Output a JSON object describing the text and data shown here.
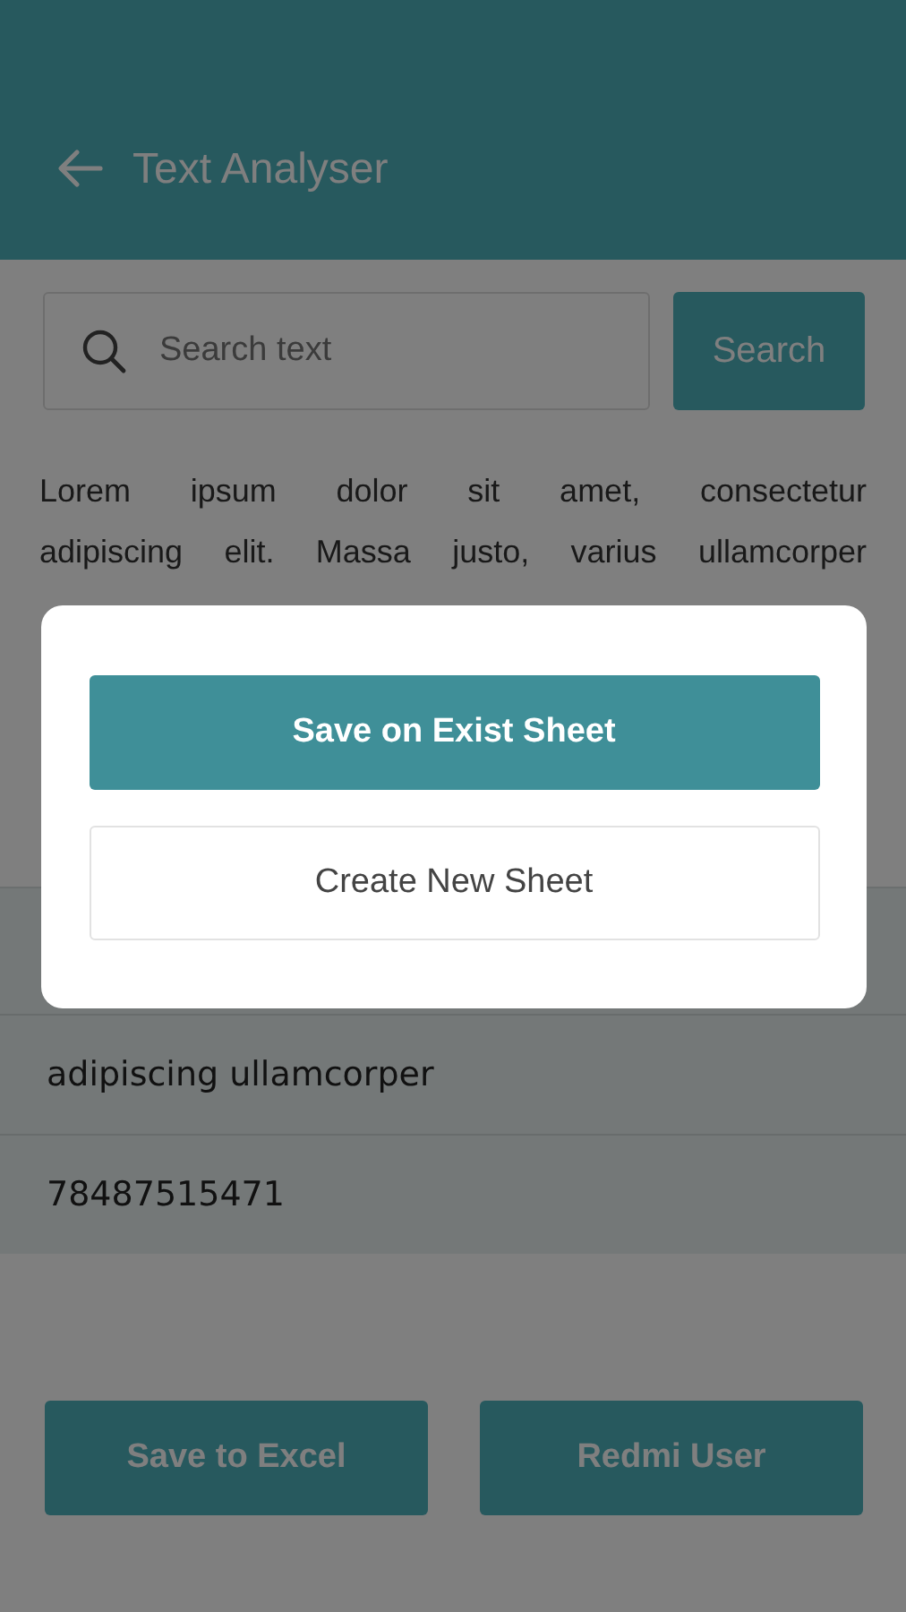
{
  "header": {
    "title": "Text Analyser"
  },
  "search": {
    "placeholder": "Search text",
    "button": "Search"
  },
  "paragraph": [
    "Lorem ipsum dolor sit amet, consectetur",
    "adipiscing elit. Massa justo, varius ullamcorper"
  ],
  "results": [
    "adipiscing ullamcorper",
    "78487515471"
  ],
  "buttons": [
    "Save to Excel",
    "Redmi User"
  ],
  "dialog": {
    "options": [
      {
        "label": "Save on Exist Sheet",
        "kind": "primary"
      },
      {
        "label": "Create New Sheet",
        "kind": "secondary"
      }
    ]
  }
}
